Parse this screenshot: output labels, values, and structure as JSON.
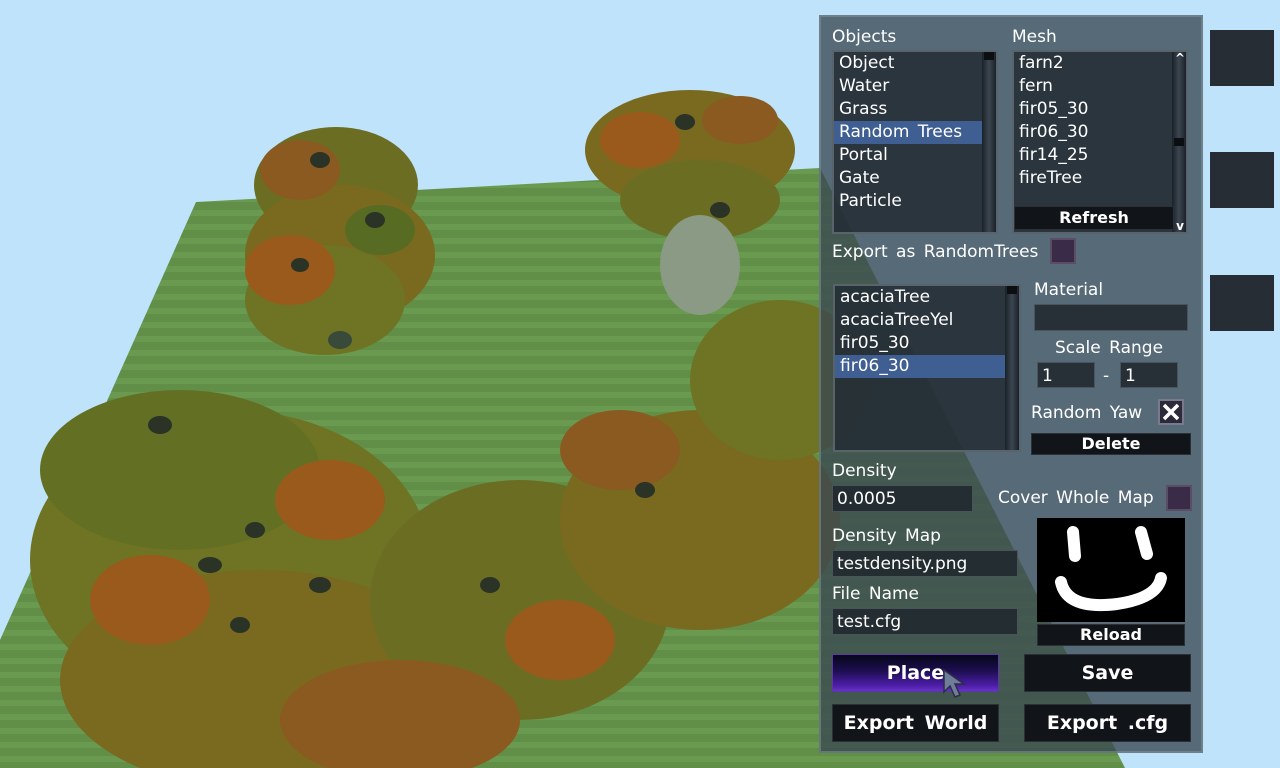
{
  "objects_panel": {
    "label": "Objects",
    "items": [
      "Object",
      "Water",
      "Grass",
      "Random Trees",
      "Portal",
      "Gate",
      "Particle"
    ],
    "selected": "Random Trees"
  },
  "mesh_panel": {
    "label": "Mesh",
    "items": [
      "farn2",
      "fern",
      "fir05_30",
      "fir06_30",
      "fir14_25",
      "fireTree"
    ],
    "scroll_up_label": "^",
    "scroll_down_label": "v",
    "refresh_label": "Refresh"
  },
  "export_random_trees": {
    "label": "Export as RandomTrees",
    "checked": false
  },
  "tree_list": {
    "items": [
      "acaciaTree",
      "acaciaTreeYel",
      "fir05_30",
      "fir06_30"
    ],
    "selected": "fir06_30"
  },
  "material": {
    "label": "Material",
    "value": ""
  },
  "scale_range": {
    "label": "Scale Range",
    "min": "1",
    "separator": "-",
    "max": "1"
  },
  "random_yaw": {
    "label": "Random Yaw",
    "checked": true
  },
  "delete_label": "Delete",
  "density": {
    "label": "Density",
    "value": "0.0005"
  },
  "cover_whole_map": {
    "label": "Cover Whole Map",
    "checked": false
  },
  "density_map": {
    "label": "Density Map",
    "value": "testdensity.png"
  },
  "file_name": {
    "label": "File Name",
    "value": "test.cfg"
  },
  "reload_label": "Reload",
  "buttons": {
    "place": "Place",
    "save": "Save",
    "export_world": "Export World",
    "export_cfg": "Export .cfg"
  },
  "colors": {
    "sky": "#bfe3fb",
    "grass": "#5e8f46",
    "panel": "#3a4852",
    "selection": "#3f5e91",
    "place_button": "#4d1ea8"
  }
}
